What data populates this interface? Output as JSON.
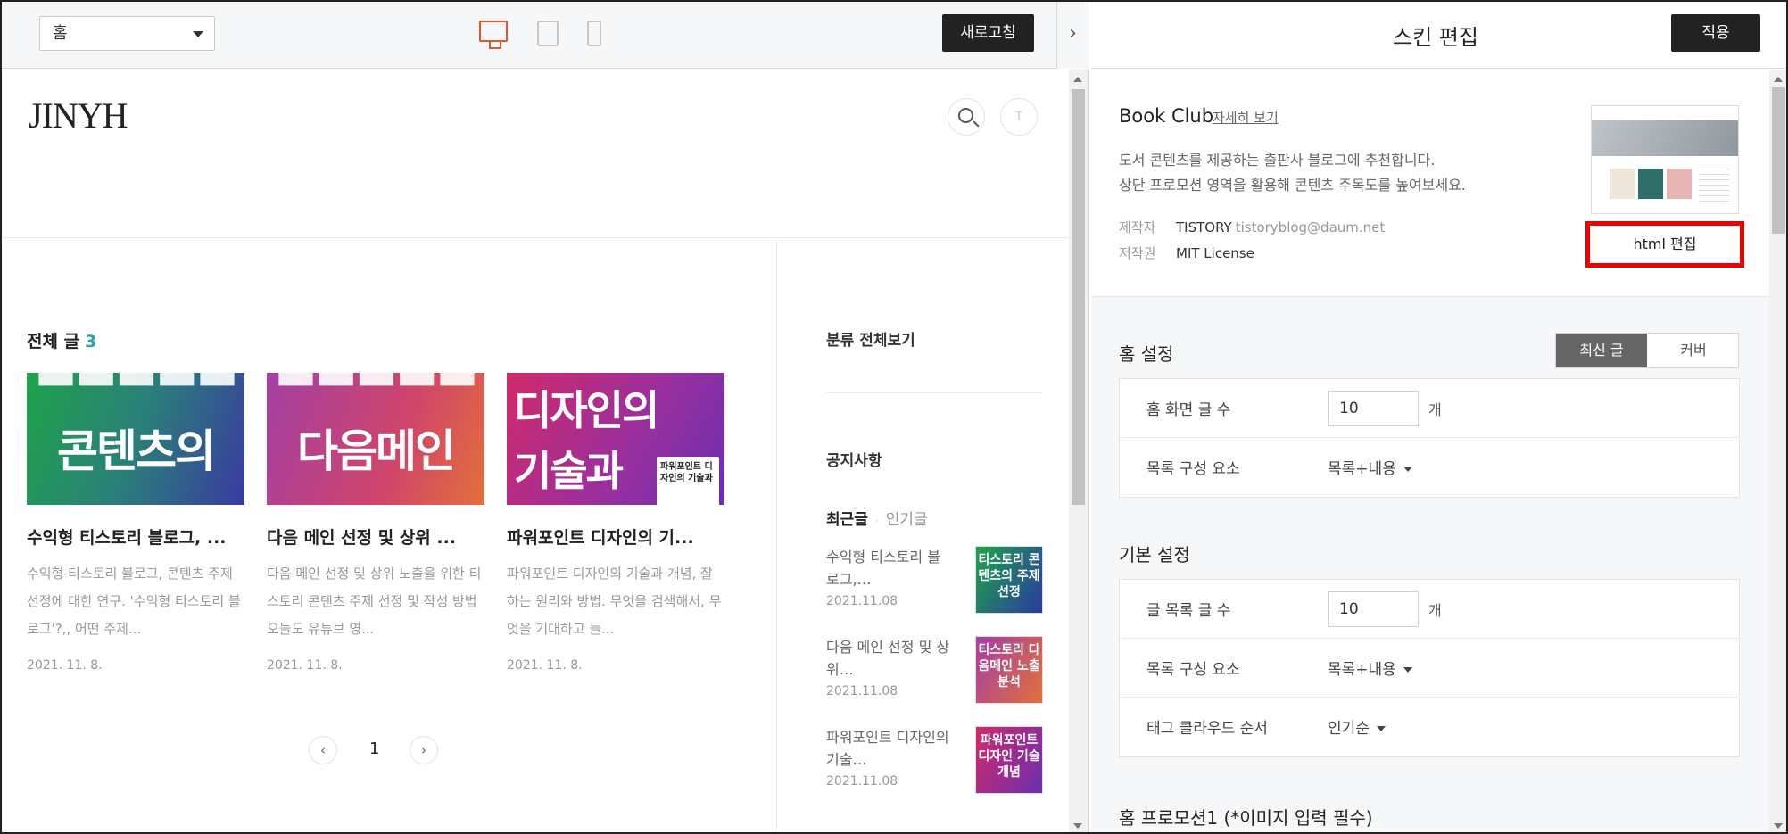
{
  "toolbar": {
    "page_select": "홈",
    "refresh_label": "새로고침",
    "collapse_icon": "chevron-right"
  },
  "preview": {
    "blog_title": "JINYH",
    "user_initial": "T",
    "section_label": "전체 글",
    "post_count": "3",
    "posts": [
      {
        "thumb_text": "콘텐츠의",
        "title": "수익형 티스토리 블로그, ...",
        "desc": "수익형 티스토리 블로그, 콘텐츠 주제 선정에 대한 연구. '수익형 티스토리 블로그'?,, 어떤 주제...",
        "date": "2021. 11. 8."
      },
      {
        "thumb_text": "다음메인",
        "title": "다음 메인 선정 및 상위 ...",
        "desc": "다음 메인 선정 및 상위 노출을 위한 티스토리 콘텐츠 주제 선정 및 작성 방법 오늘도 유튜브 영...",
        "date": "2021. 11. 8."
      },
      {
        "thumb_text": "디자인의",
        "thumb_text2": "기술과",
        "thumb_badge": "파워포인트 디자인의 기술과",
        "title": "파워포인트 디자인의 기...",
        "desc": "파워포인트 디자인의 기술과 개념, 잘하는 원리와 방법. 무엇을 검색해서, 무엇을 기대하고 들...",
        "date": "2021. 11. 8."
      }
    ],
    "pager": {
      "prev": "‹",
      "current": "1",
      "next": "›"
    },
    "sidebar": {
      "category_all": "분류 전체보기",
      "notice": "공지사항",
      "tab_recent": "최근글",
      "tab_popular": "인기글",
      "items": [
        {
          "title": "수익형 티스토리 블로그,…",
          "date": "2021.11.08",
          "thumb": "티스토리 콘텐츠의 주제선정"
        },
        {
          "title": "다음 메인 선정 및 상위…",
          "date": "2021.11.08",
          "thumb": "티스토리 다음메인 노출분석"
        },
        {
          "title": "파워포인트 디자인의 기술…",
          "date": "2021.11.08",
          "thumb": "파워포인트 디자인 기술 개념"
        }
      ]
    }
  },
  "editor": {
    "title": "스킨 편집",
    "apply_label": "적용",
    "skin_name": "Book Club",
    "detail_link": "자세히 보기",
    "desc_line1": "도서 콘텐츠를 제공하는 출판사 블로그에 추천합니다.",
    "desc_line2": "상단 프로모션 영역을 활용해 콘텐츠 주목도를 높여보세요.",
    "maker_label": "제작자",
    "maker_value": "TISTORY",
    "maker_email": "tistoryblog@daum.net",
    "license_label": "저작권",
    "license_value": "MIT License",
    "html_edit_label": "html 편집",
    "home_settings": {
      "title": "홈 설정",
      "toggle_latest": "최신 글",
      "toggle_cover": "커버",
      "rows": [
        {
          "label": "홈 화면 글 수",
          "value": "10",
          "unit": "개"
        },
        {
          "label": "목록 구성 요소",
          "value": "목록+내용"
        }
      ]
    },
    "basic_settings": {
      "title": "기본 설정",
      "rows": [
        {
          "label": "글 목록 글 수",
          "value": "10",
          "unit": "개"
        },
        {
          "label": "목록 구성 요소",
          "value": "목록+내용"
        },
        {
          "label": "태그 클라우드 순서",
          "value": "인기순"
        }
      ]
    },
    "promo_title": "홈 프로모션1 (*이미지 입력 필수)"
  },
  "colors": {
    "accent_teal": "#2aa7a0",
    "active_device": "#e4572e",
    "highlight_red": "#e00000",
    "dark_button": "#222222"
  }
}
